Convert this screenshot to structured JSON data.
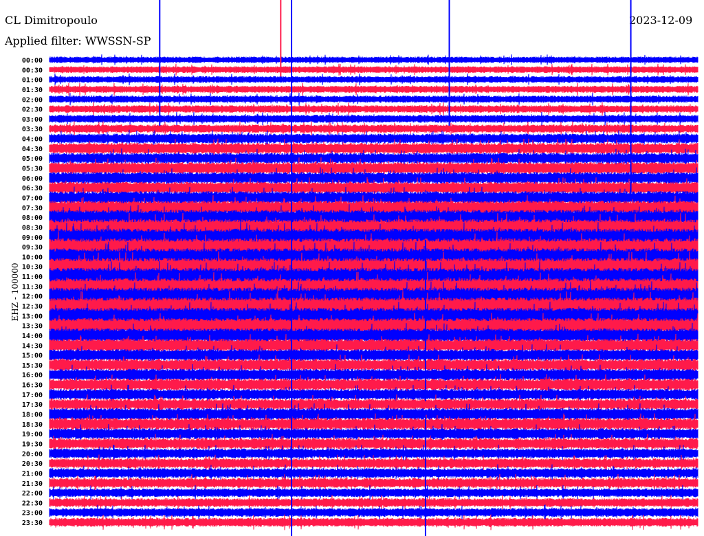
{
  "header": {
    "station": "CL Dimitropoulo",
    "filter": "Applied filter: WWSSN-SP",
    "date": "2023-12-09"
  },
  "chart_data": {
    "type": "line",
    "title": "CL Dimitropoulo",
    "subtitle": "Applied filter: WWSSN-SP",
    "ylabel": "EHZ - 100000",
    "minutes_per_line": 30,
    "colors": [
      "#0000ff",
      "#ff1a4a"
    ],
    "rows": [
      "00:00",
      "00:30",
      "01:00",
      "01:30",
      "02:00",
      "02:30",
      "03:00",
      "03:30",
      "04:00",
      "04:30",
      "05:00",
      "05:30",
      "06:00",
      "06:30",
      "07:00",
      "07:30",
      "08:00",
      "08:30",
      "09:00",
      "09:30",
      "10:00",
      "10:30",
      "11:00",
      "11:30",
      "12:00",
      "12:30",
      "13:00",
      "13:30",
      "14:00",
      "14:30",
      "15:00",
      "15:30",
      "16:00",
      "16:30",
      "17:00",
      "17:30",
      "18:00",
      "18:30",
      "19:00",
      "19:30",
      "20:00",
      "20:30",
      "21:00",
      "21:30",
      "22:00",
      "22:30",
      "23:00",
      "23:30"
    ],
    "relative_amplitude": [
      0.32,
      0.34,
      0.34,
      0.36,
      0.36,
      0.38,
      0.4,
      0.42,
      0.5,
      0.55,
      0.55,
      0.6,
      0.6,
      0.6,
      0.65,
      0.7,
      0.75,
      0.8,
      0.85,
      0.85,
      0.85,
      0.85,
      0.85,
      0.8,
      0.85,
      0.85,
      0.8,
      0.75,
      0.7,
      0.65,
      0.6,
      0.6,
      0.6,
      0.6,
      0.55,
      0.55,
      0.6,
      0.6,
      0.55,
      0.55,
      0.5,
      0.5,
      0.5,
      0.5,
      0.45,
      0.45,
      0.45,
      0.45
    ],
    "events": [
      {
        "row_start": "00:00",
        "row_end": "03:00",
        "minute": 5.1,
        "color": "#0000ff"
      },
      {
        "row_start": "00:00",
        "row_end": "23:30",
        "minute": 11.2,
        "color": "#0000ff"
      },
      {
        "row_start": "00:00",
        "row_end": "00:30",
        "minute": 10.7,
        "color": "#ff1a4a"
      },
      {
        "row_start": "00:00",
        "row_end": "03:00",
        "minute": 18.5,
        "color": "#0000ff"
      },
      {
        "row_start": "00:00",
        "row_end": "06:30",
        "minute": 26.9,
        "color": "#0000ff"
      },
      {
        "row_start": "09:30",
        "row_end": "17:00",
        "minute": 17.4,
        "color": "#0000ff"
      },
      {
        "row_start": "18:30",
        "row_end": "23:30",
        "minute": 17.4,
        "color": "#0000ff"
      }
    ]
  }
}
